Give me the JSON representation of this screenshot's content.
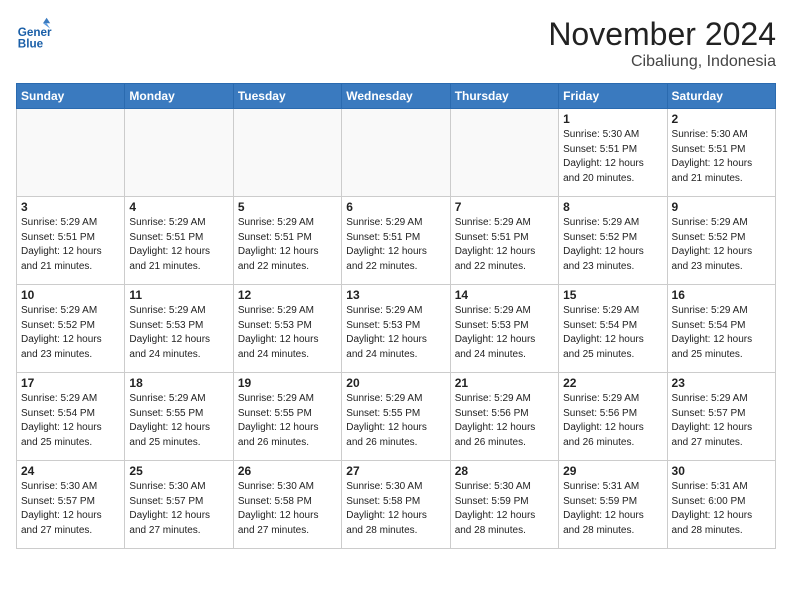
{
  "header": {
    "logo_line1": "General",
    "logo_line2": "Blue",
    "month": "November 2024",
    "location": "Cibaliung, Indonesia"
  },
  "weekdays": [
    "Sunday",
    "Monday",
    "Tuesday",
    "Wednesday",
    "Thursday",
    "Friday",
    "Saturday"
  ],
  "weeks": [
    [
      {
        "day": "",
        "info": ""
      },
      {
        "day": "",
        "info": ""
      },
      {
        "day": "",
        "info": ""
      },
      {
        "day": "",
        "info": ""
      },
      {
        "day": "",
        "info": ""
      },
      {
        "day": "1",
        "info": "Sunrise: 5:30 AM\nSunset: 5:51 PM\nDaylight: 12 hours\nand 20 minutes."
      },
      {
        "day": "2",
        "info": "Sunrise: 5:30 AM\nSunset: 5:51 PM\nDaylight: 12 hours\nand 21 minutes."
      }
    ],
    [
      {
        "day": "3",
        "info": "Sunrise: 5:29 AM\nSunset: 5:51 PM\nDaylight: 12 hours\nand 21 minutes."
      },
      {
        "day": "4",
        "info": "Sunrise: 5:29 AM\nSunset: 5:51 PM\nDaylight: 12 hours\nand 21 minutes."
      },
      {
        "day": "5",
        "info": "Sunrise: 5:29 AM\nSunset: 5:51 PM\nDaylight: 12 hours\nand 22 minutes."
      },
      {
        "day": "6",
        "info": "Sunrise: 5:29 AM\nSunset: 5:51 PM\nDaylight: 12 hours\nand 22 minutes."
      },
      {
        "day": "7",
        "info": "Sunrise: 5:29 AM\nSunset: 5:51 PM\nDaylight: 12 hours\nand 22 minutes."
      },
      {
        "day": "8",
        "info": "Sunrise: 5:29 AM\nSunset: 5:52 PM\nDaylight: 12 hours\nand 23 minutes."
      },
      {
        "day": "9",
        "info": "Sunrise: 5:29 AM\nSunset: 5:52 PM\nDaylight: 12 hours\nand 23 minutes."
      }
    ],
    [
      {
        "day": "10",
        "info": "Sunrise: 5:29 AM\nSunset: 5:52 PM\nDaylight: 12 hours\nand 23 minutes."
      },
      {
        "day": "11",
        "info": "Sunrise: 5:29 AM\nSunset: 5:53 PM\nDaylight: 12 hours\nand 24 minutes."
      },
      {
        "day": "12",
        "info": "Sunrise: 5:29 AM\nSunset: 5:53 PM\nDaylight: 12 hours\nand 24 minutes."
      },
      {
        "day": "13",
        "info": "Sunrise: 5:29 AM\nSunset: 5:53 PM\nDaylight: 12 hours\nand 24 minutes."
      },
      {
        "day": "14",
        "info": "Sunrise: 5:29 AM\nSunset: 5:53 PM\nDaylight: 12 hours\nand 24 minutes."
      },
      {
        "day": "15",
        "info": "Sunrise: 5:29 AM\nSunset: 5:54 PM\nDaylight: 12 hours\nand 25 minutes."
      },
      {
        "day": "16",
        "info": "Sunrise: 5:29 AM\nSunset: 5:54 PM\nDaylight: 12 hours\nand 25 minutes."
      }
    ],
    [
      {
        "day": "17",
        "info": "Sunrise: 5:29 AM\nSunset: 5:54 PM\nDaylight: 12 hours\nand 25 minutes."
      },
      {
        "day": "18",
        "info": "Sunrise: 5:29 AM\nSunset: 5:55 PM\nDaylight: 12 hours\nand 25 minutes."
      },
      {
        "day": "19",
        "info": "Sunrise: 5:29 AM\nSunset: 5:55 PM\nDaylight: 12 hours\nand 26 minutes."
      },
      {
        "day": "20",
        "info": "Sunrise: 5:29 AM\nSunset: 5:55 PM\nDaylight: 12 hours\nand 26 minutes."
      },
      {
        "day": "21",
        "info": "Sunrise: 5:29 AM\nSunset: 5:56 PM\nDaylight: 12 hours\nand 26 minutes."
      },
      {
        "day": "22",
        "info": "Sunrise: 5:29 AM\nSunset: 5:56 PM\nDaylight: 12 hours\nand 26 minutes."
      },
      {
        "day": "23",
        "info": "Sunrise: 5:29 AM\nSunset: 5:57 PM\nDaylight: 12 hours\nand 27 minutes."
      }
    ],
    [
      {
        "day": "24",
        "info": "Sunrise: 5:30 AM\nSunset: 5:57 PM\nDaylight: 12 hours\nand 27 minutes."
      },
      {
        "day": "25",
        "info": "Sunrise: 5:30 AM\nSunset: 5:57 PM\nDaylight: 12 hours\nand 27 minutes."
      },
      {
        "day": "26",
        "info": "Sunrise: 5:30 AM\nSunset: 5:58 PM\nDaylight: 12 hours\nand 27 minutes."
      },
      {
        "day": "27",
        "info": "Sunrise: 5:30 AM\nSunset: 5:58 PM\nDaylight: 12 hours\nand 28 minutes."
      },
      {
        "day": "28",
        "info": "Sunrise: 5:30 AM\nSunset: 5:59 PM\nDaylight: 12 hours\nand 28 minutes."
      },
      {
        "day": "29",
        "info": "Sunrise: 5:31 AM\nSunset: 5:59 PM\nDaylight: 12 hours\nand 28 minutes."
      },
      {
        "day": "30",
        "info": "Sunrise: 5:31 AM\nSunset: 6:00 PM\nDaylight: 12 hours\nand 28 minutes."
      }
    ]
  ]
}
